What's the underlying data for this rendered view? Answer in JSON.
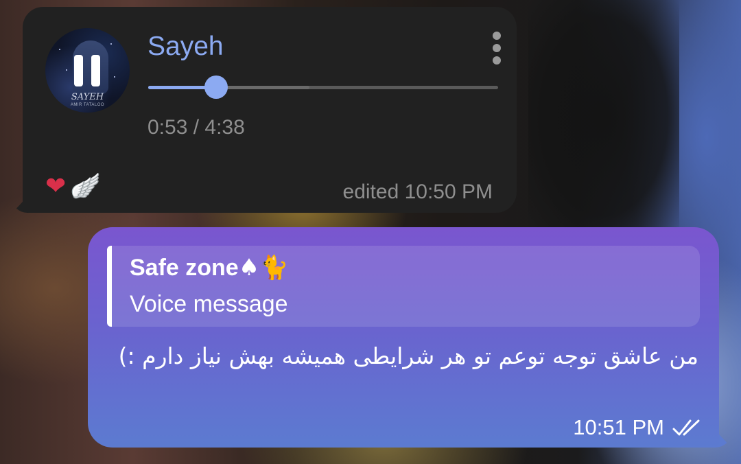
{
  "voice_message": {
    "cover_art_text": "SAYEH",
    "cover_art_subtext": "AMIR TATALOO",
    "title": "Sayeh",
    "progress_fraction": 0.195,
    "buffered_fraction": 0.46,
    "time_readout": "0:53 / 4:38",
    "reactions": [
      {
        "name": "anatomical-heart",
        "glyph": "❤"
      },
      {
        "name": "wing",
        "glyph": "🪽"
      }
    ],
    "edited_stamp": "edited 10:50 PM"
  },
  "reply_message": {
    "quoted_sender": "Safe zone",
    "quoted_sender_emoji": "♠🐈",
    "quoted_text": "Voice message",
    "text": "من عاشق توجه توعم تو هر شرایطی همیشه بهش نیاز دارم :)",
    "time": "10:51 PM",
    "status": "read"
  },
  "colors": {
    "incoming_bubble": "#212121",
    "accent": "#8caaf2",
    "outgoing_gradient_top": "#7a56cf",
    "outgoing_gradient_bottom": "#5c7bd0",
    "secondary_text": "#8f8f8f"
  }
}
